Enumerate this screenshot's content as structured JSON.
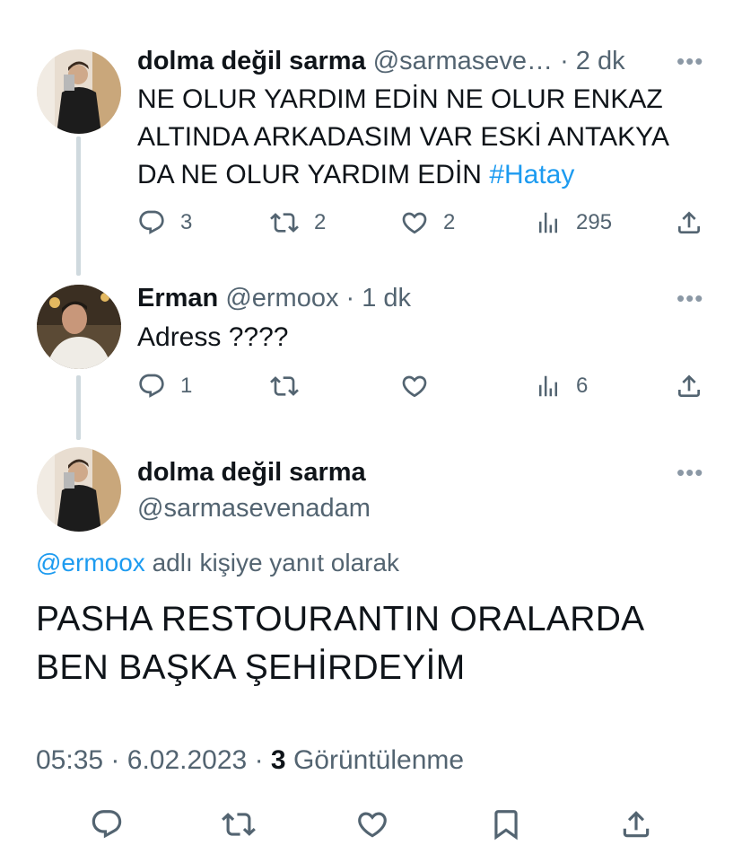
{
  "tweet1": {
    "name": "dolma değil sarma",
    "handle": "@sarmaseve…",
    "time": "· 2 dk",
    "lines": [
      "NE OLUR YARDIM EDİN NE OLUR ENKAZ",
      "ALTINDA ARKADASIM VAR ESKİ ANTAKYA"
    ],
    "line3_prefix": "DA NE OLUR YARDIM EDİN ",
    "hashtag": "#Hatay",
    "replies": "3",
    "retweets": "2",
    "likes": "2",
    "views": "295"
  },
  "tweet2": {
    "name": "Erman",
    "handle": "@ermoox",
    "time": "· 1 dk",
    "text": "Adress ????",
    "replies": "1",
    "views": "6"
  },
  "main": {
    "name": "dolma değil sarma",
    "handle": "@sarmasevenadam",
    "reply_to_handle": "@ermoox",
    "reply_to_suffix": " adlı kişiye yanıt olarak",
    "lines": [
      "PASHA RESTOURANTIN ORALARDA",
      "BEN BAŞKA ŞEHİRDEYİM"
    ],
    "time": "05:35",
    "date": "6.02.2023",
    "views_count": "3",
    "views_label": "Görüntülenme"
  },
  "icons": [
    "reply-icon",
    "retweet-icon",
    "like-icon",
    "views-icon",
    "share-icon",
    "bookmark-icon",
    "more-icon"
  ],
  "colors": {
    "text": "#0f1419",
    "muted": "#536471",
    "link": "#1d9bf0",
    "thread_line": "#cfd9de"
  }
}
